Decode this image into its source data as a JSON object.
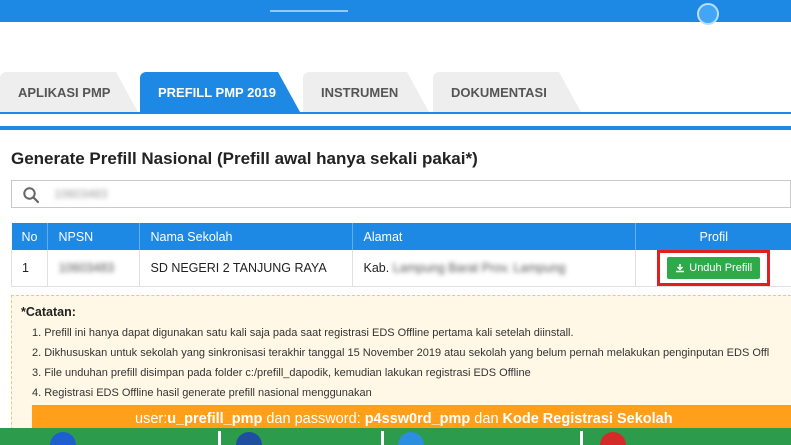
{
  "tabs": [
    {
      "label": "APLIKASI PMP",
      "active": false
    },
    {
      "label": "PREFILL PMP 2019",
      "active": true
    },
    {
      "label": "INSTRUMEN",
      "active": false
    },
    {
      "label": "DOKUMENTASI",
      "active": false
    }
  ],
  "page_title": "Generate Prefill Nasional (Prefill awal hanya sekali pakai*)",
  "search": {
    "value": "10603483"
  },
  "table": {
    "headers": [
      "No",
      "NPSN",
      "Nama Sekolah",
      "Alamat",
      "Profil"
    ],
    "rows": [
      {
        "no": "1",
        "npsn": "10603483",
        "nama": "SD NEGERI 2 TANJUNG RAYA",
        "alamat_prefix": "Kab.",
        "alamat_rest": "Lampung Barat Prov. Lampung",
        "button": "Unduh Prefill"
      }
    ]
  },
  "notes": {
    "heading": "*Catatan:",
    "items": [
      "1. Prefill ini hanya dapat digunakan satu kali saja pada saat registrasi EDS Offline pertama kali setelah diinstall.",
      "2. Dikhususkan untuk sekolah yang sinkronisasi terakhir tanggal 15 November 2019 atau sekolah yang belum pernah melakukan penginputan EDS Offl",
      "3. File unduhan prefill disimpan pada folder c:/prefill_dapodik, kemudian lakukan registrasi EDS Offline",
      "4. Registrasi EDS Offline hasil generate prefill nasional menggunakan"
    ]
  },
  "banner": {
    "t1": "user: ",
    "user": "u_prefill_pmp",
    "t2": " dan password: ",
    "pass": "p4ssw0rd_pmp",
    "t3": " dan ",
    "t4": "Kode Registrasi Sekolah"
  },
  "colors": {
    "primary": "#1e88e5",
    "success": "#2eaa4b",
    "highlight": "#e02020",
    "banner": "#ff9f1a",
    "footer": "#2d9b4c"
  }
}
